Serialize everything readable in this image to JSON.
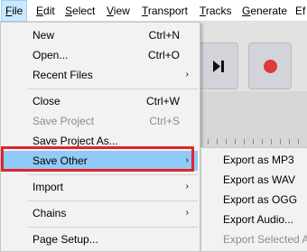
{
  "menubar": {
    "items": [
      {
        "label": "File",
        "mnemonic": "F",
        "rest": "ile"
      },
      {
        "label": "Edit",
        "mnemonic": "E",
        "rest": "dit"
      },
      {
        "label": "Select",
        "mnemonic": "S",
        "rest": "elect"
      },
      {
        "label": "View",
        "mnemonic": "V",
        "rest": "iew"
      },
      {
        "label": "Transport",
        "mnemonic": "T",
        "rest": "ransport"
      },
      {
        "label": "Tracks",
        "mnemonic": "T",
        "rest": "racks"
      },
      {
        "label": "Generate",
        "mnemonic": "G",
        "rest": "enerate"
      },
      {
        "label": "Ef",
        "mnemonic": "",
        "rest": "Ef"
      }
    ]
  },
  "toolbar": {
    "skip_end_icon": "skip-to-end-icon",
    "record_icon": "record-icon",
    "record_color": "#de3a3a"
  },
  "file_menu": {
    "items": [
      {
        "label": "New",
        "shortcut": "Ctrl+N"
      },
      {
        "label": "Open...",
        "shortcut": "Ctrl+O"
      },
      {
        "label": "Recent Files",
        "submenu": true
      },
      {
        "label": "Close",
        "shortcut": "Ctrl+W"
      },
      {
        "label": "Save Project",
        "shortcut": "Ctrl+S",
        "disabled": true
      },
      {
        "label": "Save Project As..."
      },
      {
        "label": "Save Other",
        "submenu": true,
        "highlighted": true
      },
      {
        "label": "Import",
        "submenu": true
      },
      {
        "label": "Chains",
        "submenu": true
      },
      {
        "label": "Page Setup..."
      }
    ],
    "arrow": "›"
  },
  "save_other_submenu": {
    "items": [
      {
        "label": "Export as MP3"
      },
      {
        "label": "Export as WAV"
      },
      {
        "label": "Export as OGG"
      },
      {
        "label": "Export Audio..."
      },
      {
        "label": "Export Selected Au",
        "disabled": true
      }
    ]
  },
  "colors": {
    "highlight": "#91c9f7",
    "focus_outline": "#e0252b"
  }
}
